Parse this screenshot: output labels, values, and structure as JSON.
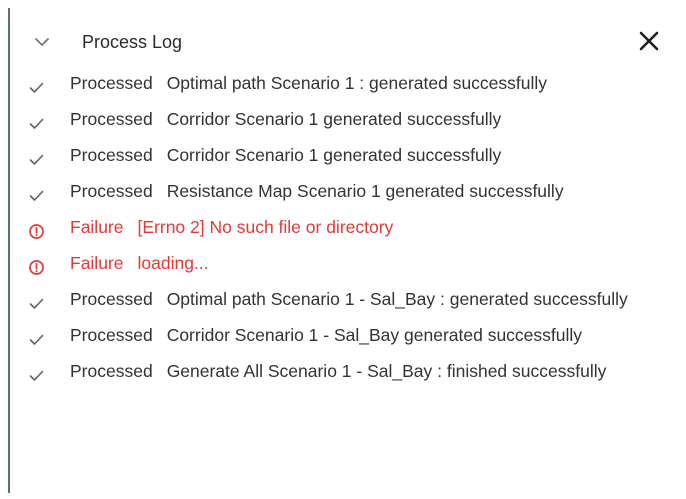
{
  "panel": {
    "title": "Process Log"
  },
  "colors": {
    "text": "#333333",
    "failure": "#e53935",
    "icon": "#5f6368"
  },
  "entries": [
    {
      "status": "Processed",
      "type": "success",
      "icon": "checkmark-icon",
      "message": "Optimal path Scenario 1 : generated successfully"
    },
    {
      "status": "Processed",
      "type": "success",
      "icon": "checkmark-icon",
      "message": "Corridor Scenario 1 generated successfully"
    },
    {
      "status": "Processed",
      "type": "success",
      "icon": "checkmark-icon",
      "message": "Corridor Scenario 1 generated successfully"
    },
    {
      "status": "Processed",
      "type": "success",
      "icon": "checkmark-icon",
      "message": "Resistance Map Scenario 1 generated successfully"
    },
    {
      "status": "Failure",
      "type": "failure",
      "icon": "error-circle-icon",
      "message": "[Errno 2] No such file or directory"
    },
    {
      "status": "Failure",
      "type": "failure",
      "icon": "error-circle-icon",
      "message": "loading..."
    },
    {
      "status": "Processed",
      "type": "success",
      "icon": "checkmark-icon",
      "message": "Optimal path Scenario 1 - Sal_Bay : generated successfully"
    },
    {
      "status": "Processed",
      "type": "success",
      "icon": "checkmark-icon",
      "message": "Corridor Scenario 1 - Sal_Bay generated successfully"
    },
    {
      "status": "Processed",
      "type": "success",
      "icon": "checkmark-icon",
      "message": "Generate All Scenario 1 - Sal_Bay : finished successfully"
    }
  ]
}
